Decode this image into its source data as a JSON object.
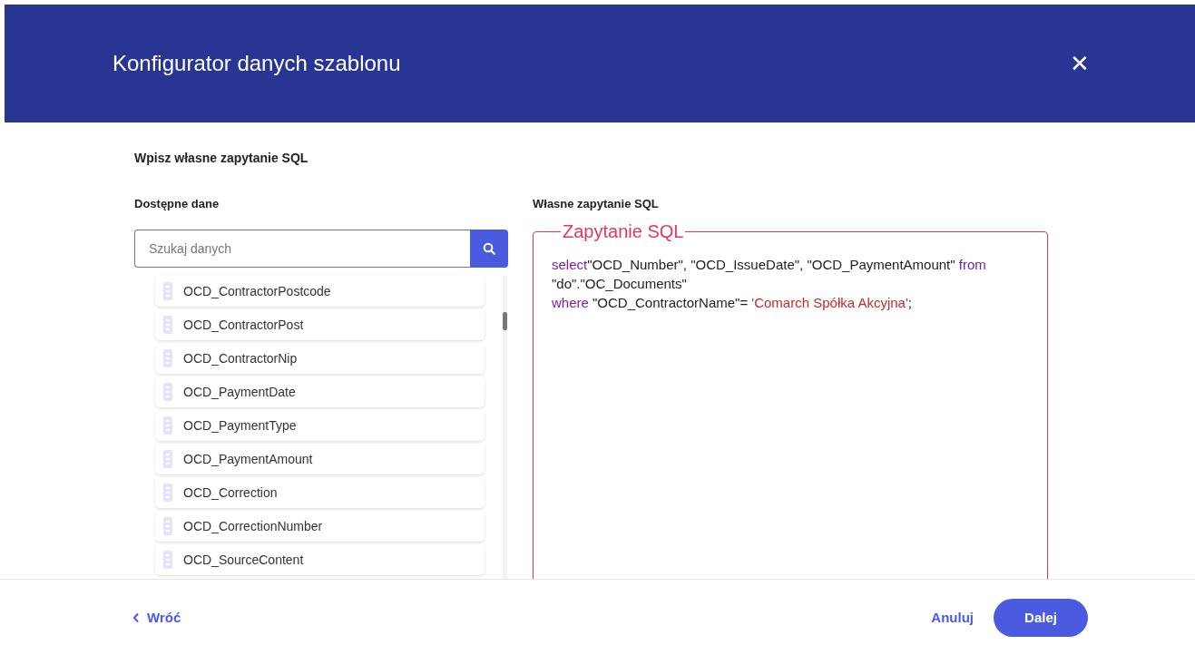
{
  "header": {
    "title": "Konfigurator danych szablonu",
    "close": "✕"
  },
  "section_title": "Wpisz własne zapytanie SQL",
  "available": {
    "label": "Dostępne dane",
    "search": {
      "placeholder": "Szukaj danych"
    },
    "items": [
      "OCD_ContractorPostcode",
      "OCD_ContractorPost",
      "OCD_ContractorNip",
      "OCD_PaymentDate",
      "OCD_PaymentType",
      "OCD_PaymentAmount",
      "OCD_Correction",
      "OCD_CorrectionNumber",
      "OCD_SourceContent"
    ]
  },
  "query": {
    "label": "Własne zapytanie SQL",
    "legend": "Zapytanie SQL",
    "lines": [
      [
        {
          "kind": "keyword",
          "text": "select"
        },
        {
          "kind": "plain",
          "text": "\"OCD_Number\", \"OCD_IssueDate\", \"OCD_PaymentAmount\" "
        },
        {
          "kind": "keyword",
          "text": "from"
        }
      ],
      [
        {
          "kind": "plain",
          "text": "\"do\".\"OC_Documents\""
        }
      ],
      [
        {
          "kind": "keyword",
          "text": "where"
        },
        {
          "kind": "plain",
          "text": " \"OCD_ContractorName\"= "
        },
        {
          "kind": "string",
          "text": "'Comarch Spółka Akcyjna'"
        },
        {
          "kind": "plain",
          "text": ";"
        }
      ]
    ]
  },
  "footer": {
    "back": "Wróć",
    "cancel": "Anuluj",
    "next": "Dalej"
  }
}
